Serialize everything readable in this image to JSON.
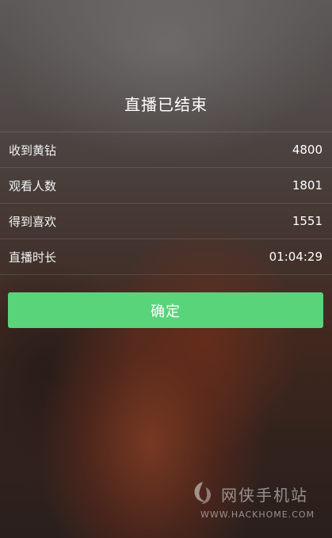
{
  "header": {
    "title": "直播已结束"
  },
  "stats": [
    {
      "label": "收到黄钻",
      "value": "4800"
    },
    {
      "label": "观看人数",
      "value": "1801"
    },
    {
      "label": "得到喜欢",
      "value": "1551"
    },
    {
      "label": "直播时长",
      "value": "01:04:29"
    }
  ],
  "confirm_button": {
    "label": "确定",
    "color": "#5ad47a"
  },
  "watermark": {
    "brand": "网侠手机站",
    "url": "WWW.HACKHOME.COM",
    "icon": "hackhome-logo"
  }
}
